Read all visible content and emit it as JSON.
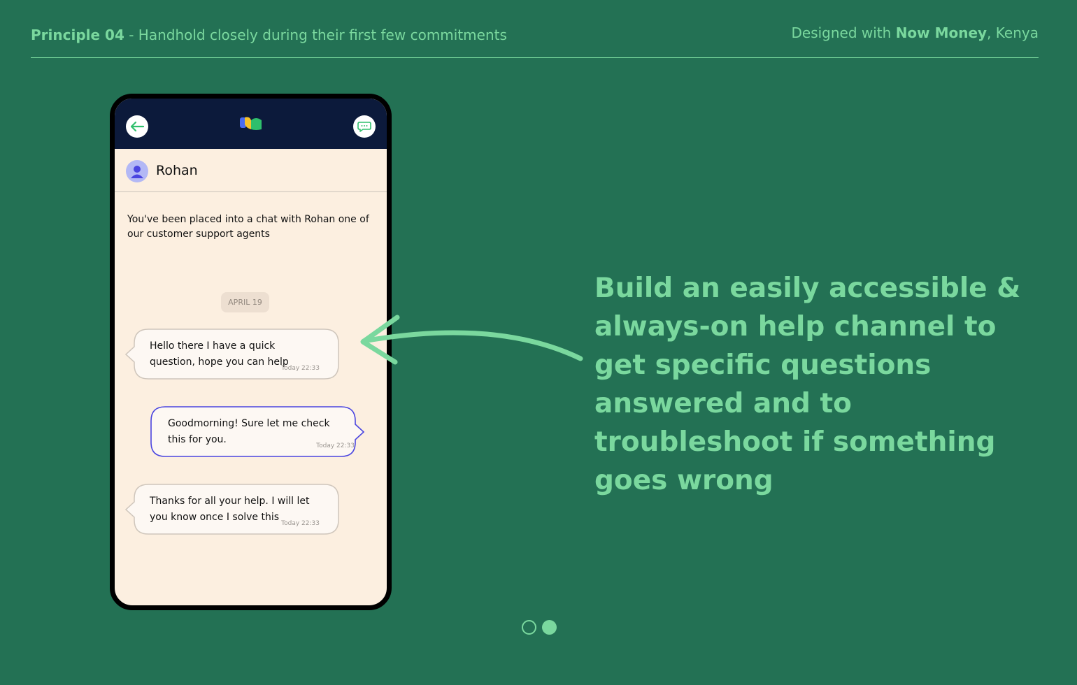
{
  "header": {
    "principle_label": "Principle 04",
    "principle_text": " - Handhold closely during their first few commitments",
    "designed_prefix": "Designed with ",
    "brand": "Now Money",
    "location": ", Kenya"
  },
  "phone": {
    "agent_name": "Rohan",
    "system_message": "You've been placed into a chat with Rohan one of our customer support agents",
    "date_chip": "APRIL 19",
    "messages": [
      {
        "text": "Hello there I have a quick question, hope you can help",
        "time": "Today 22:33",
        "side": "left"
      },
      {
        "text": "Goodmorning! Sure let me check this for you.",
        "time": "Today 22:33",
        "side": "right"
      },
      {
        "text": "Thanks for all your help. I will let you know once I solve this",
        "time": "Today 22:33",
        "side": "left"
      }
    ]
  },
  "headline": "Build an easily accessible & always-on help channel to get specific questions answered and to troubleshoot if something goes wrong",
  "pager": {
    "active_index": 1
  },
  "colors": {
    "background": "#237154",
    "accent": "#7ad89e",
    "phone_header": "#0c1a3b",
    "chat_background": "#fcefe0",
    "agent_bubble_border": "#4a45e0"
  },
  "icons": {
    "back": "arrow-left-icon",
    "chat": "chat-bubble-icon",
    "avatar": "user-icon",
    "logo": "now-money-logo"
  }
}
